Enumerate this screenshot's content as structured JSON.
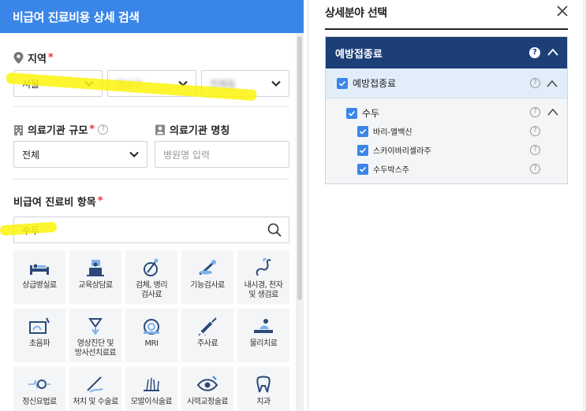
{
  "left": {
    "header_title": "비급여 진료비용 상세 검색",
    "region": {
      "label": "지역",
      "required_mark": "*",
      "city": "서울",
      "district": "강남구",
      "dong": "전체동"
    },
    "facility_size": {
      "label": "의료기관 규모",
      "required_mark": "*",
      "help": "?",
      "value": "전체"
    },
    "facility_name": {
      "label": "의료기관 명칭",
      "placeholder": "병원명 입력"
    },
    "item": {
      "label": "비급여 진료비 항목",
      "required_mark": "*",
      "search_value": "수두"
    },
    "categories": [
      {
        "label": "상급병실료",
        "icon": "hospital-bed-icon"
      },
      {
        "label": "교육상담료",
        "icon": "consultation-icon"
      },
      {
        "label": "검체, 병리\n검사료",
        "icon": "pathology-test-icon"
      },
      {
        "label": "기능검사료",
        "icon": "function-test-icon"
      },
      {
        "label": "내시경, 천자\n및 생검료",
        "icon": "endoscope-icon"
      },
      {
        "label": "초음파",
        "icon": "ultrasound-icon"
      },
      {
        "label": "영상진단 및\n방사선치료료",
        "icon": "radiology-icon"
      },
      {
        "label": "MRI",
        "icon": "mri-icon"
      },
      {
        "label": "주사료",
        "icon": "syringe-icon"
      },
      {
        "label": "물리치료",
        "icon": "physical-therapy-icon"
      },
      {
        "label": "정신요법료",
        "icon": "psychotherapy-icon"
      },
      {
        "label": "처치 및 수술료",
        "icon": "surgery-icon"
      },
      {
        "label": "모발이식술료",
        "icon": "hair-transplant-icon"
      },
      {
        "label": "시력교정술료",
        "icon": "eye-icon"
      },
      {
        "label": "치과",
        "icon": "tooth-icon"
      }
    ]
  },
  "right": {
    "title": "상세분야 선택",
    "close": "×",
    "tree": {
      "root": "예방접종료",
      "help": "?",
      "level1": "예방접종료",
      "level2": "수두",
      "level3": [
        "바리-엘백신",
        "스카이바리셀라주",
        "수두박스주"
      ]
    }
  },
  "colors": {
    "header_blue": "#3a86e8",
    "tree_navy": "#1c3f78",
    "checkbox_blue": "#3a86e8",
    "highlight_yellow": "#fbf30a",
    "required_red": "#e33333"
  }
}
